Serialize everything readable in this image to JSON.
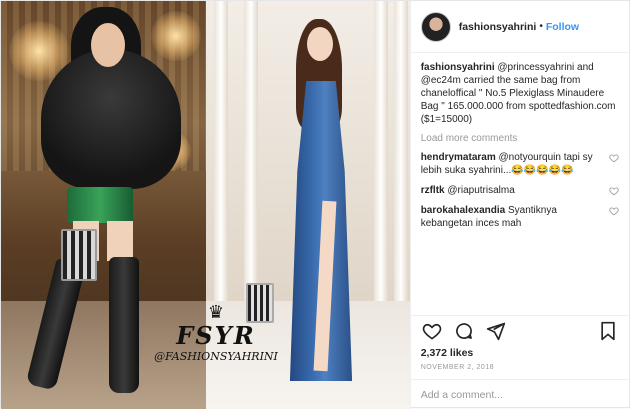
{
  "header": {
    "username": "fashionsyahrini",
    "separator": "•",
    "follow_label": "Follow"
  },
  "media": {
    "watermark": {
      "logo": "FSYR",
      "handle": "@FASHIONSYAHRINI"
    }
  },
  "caption": {
    "username": "fashionsyahrini",
    "text": "@princessyahrini and @ec24m carried the same bag from chaneloffical \" No.5 Plexiglass Minaudere Bag \" 165.000.000 from spottedfashion.com ($1=15000)"
  },
  "load_more_label": "Load more comments",
  "comments": [
    {
      "username": "hendrymataram",
      "text": "@notyourquin tapi sy lebih suka syahrini...😂😂😂😂😂"
    },
    {
      "username": "rzfltk",
      "text": "@riaputrisalma"
    },
    {
      "username": "barokahalexandia",
      "text": "Syantiknya kebangetan inces mah"
    }
  ],
  "likes": "2,372 likes",
  "date": "NOVEMBER 2, 2018",
  "add_comment_placeholder": "Add a comment...",
  "colors": {
    "link": "#3897f0",
    "muted": "#999999",
    "text": "#262626"
  },
  "icons": [
    "heart-icon",
    "comment-icon",
    "share-icon",
    "bookmark-icon"
  ]
}
